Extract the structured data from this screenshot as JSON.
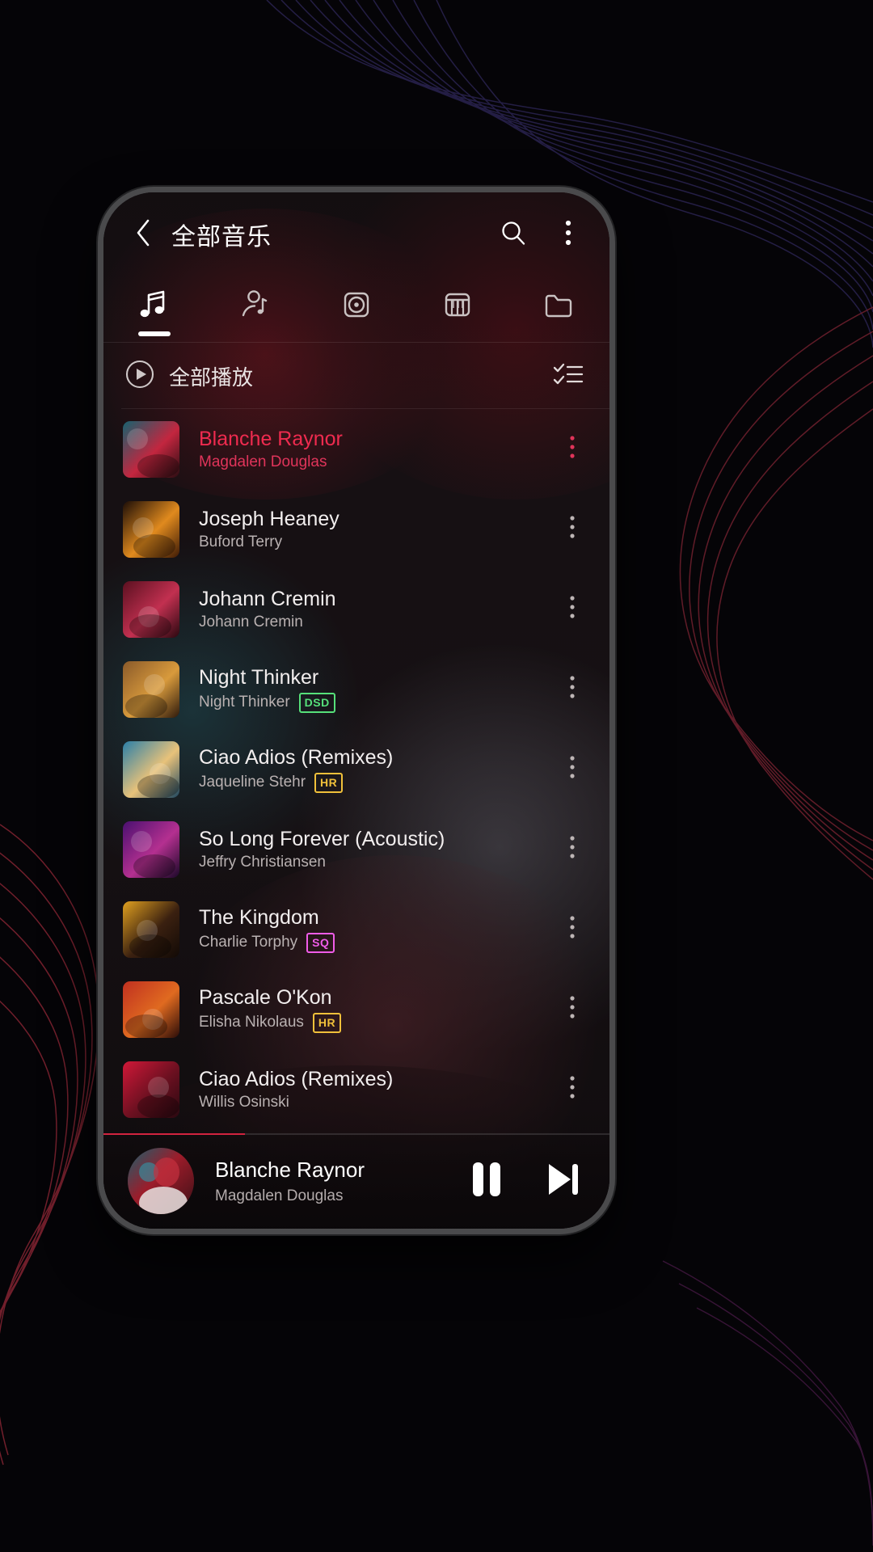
{
  "header": {
    "title": "全部音乐",
    "back_icon": "chevron-left-icon",
    "search_icon": "search-icon",
    "overflow_icon": "more-vertical-icon"
  },
  "tabs": [
    {
      "id": "songs",
      "icon": "music-note-icon",
      "active": true
    },
    {
      "id": "artists",
      "icon": "artist-icon",
      "active": false
    },
    {
      "id": "albums",
      "icon": "album-disc-icon",
      "active": false
    },
    {
      "id": "genres",
      "icon": "piano-keys-icon",
      "active": false
    },
    {
      "id": "folders",
      "icon": "folder-icon",
      "active": false
    }
  ],
  "play_all": {
    "label": "全部播放",
    "play_icon": "play-circle-icon",
    "multiselect_icon": "checklist-icon"
  },
  "songs": [
    {
      "title": "Blanche Raynor",
      "artist": "Magdalen Douglas",
      "badge": "",
      "playing": true
    },
    {
      "title": "Joseph Heaney",
      "artist": "Buford Terry",
      "badge": "",
      "playing": false
    },
    {
      "title": "Johann Cremin",
      "artist": "Johann Cremin",
      "badge": "",
      "playing": false
    },
    {
      "title": "Night Thinker",
      "artist": "Night Thinker",
      "badge": "DSD",
      "playing": false
    },
    {
      "title": "Ciao Adios (Remixes)",
      "artist": "Jaqueline Stehr",
      "badge": "HR",
      "playing": false
    },
    {
      "title": "So Long Forever (Acoustic)",
      "artist": "Jeffry Christiansen",
      "badge": "",
      "playing": false
    },
    {
      "title": "The Kingdom",
      "artist": "Charlie Torphy",
      "badge": "SQ",
      "playing": false
    },
    {
      "title": "Pascale O'Kon",
      "artist": "Elisha Nikolaus",
      "badge": "HR",
      "playing": false
    },
    {
      "title": "Ciao Adios (Remixes)",
      "artist": "Willis Osinski",
      "badge": "",
      "playing": false
    }
  ],
  "now_playing": {
    "title": "Blanche Raynor",
    "artist": "Magdalen Douglas",
    "pause_icon": "pause-icon",
    "next_icon": "skip-next-icon",
    "progress_percent": 28
  },
  "colors": {
    "accent_red": "#ef2b4f",
    "badge_dsd": "#56e07a",
    "badge_hr": "#f0c03a",
    "badge_sq": "#f05ce8",
    "text_primary": "#f2eeee",
    "text_secondary": "#b9b1b1"
  }
}
